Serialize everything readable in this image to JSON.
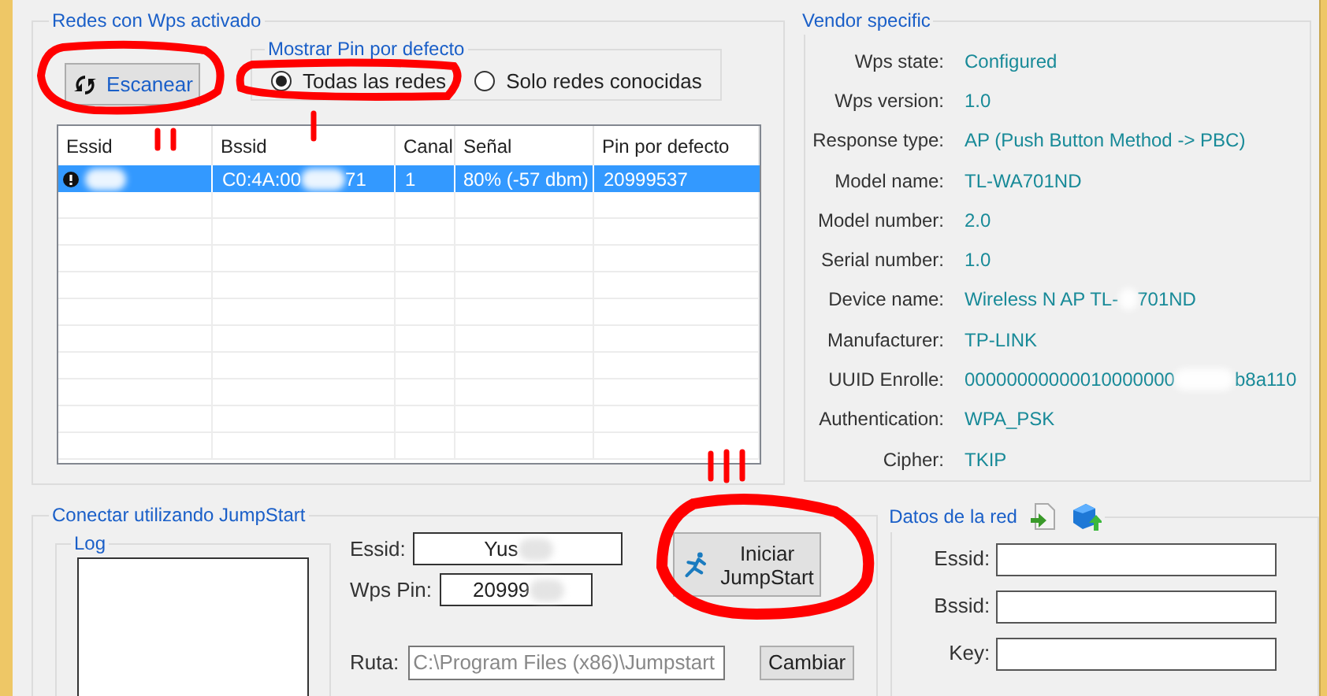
{
  "scan_group": {
    "title": "Redes con Wps activado",
    "scan_button": "Escanear",
    "pin_filter": {
      "title": "Mostrar Pin por defecto",
      "options": [
        {
          "label": "Todas las redes",
          "selected": true
        },
        {
          "label": "Solo redes conocidas",
          "selected": false
        }
      ]
    }
  },
  "table": {
    "columns": [
      "Essid",
      "Bssid",
      "Canal",
      "Señal",
      "Pin por defecto"
    ],
    "rows": [
      {
        "selected": true,
        "bssid_start": "C0:4A:00",
        "bssid_end": "71",
        "canal": "1",
        "senal": "80% (-57 dbm)",
        "pin": "20999537"
      }
    ]
  },
  "vendor": {
    "title": "Vendor specific",
    "rows": [
      {
        "label": "Wps state:",
        "value": "Configured"
      },
      {
        "label": "Wps version:",
        "value": "1.0"
      },
      {
        "label": "Response type:",
        "value": "AP (Push Button Method -> PBC)"
      },
      {
        "label": "Model name:",
        "value": "TL-WA701ND"
      },
      {
        "label": "Model number:",
        "value": "2.0"
      },
      {
        "label": "Serial number:",
        "value": "1.0"
      },
      {
        "label": "Device name:",
        "value": "Wireless N AP TL-",
        "value_end": "701ND"
      },
      {
        "label": "Manufacturer:",
        "value": "TP-LINK"
      },
      {
        "label": "UUID Enrolle:",
        "value": "00000000000010000000",
        "value_end": "b8a110"
      },
      {
        "label": "Authentication:",
        "value": "WPA_PSK"
      },
      {
        "label": "Cipher:",
        "value": "TKIP"
      }
    ]
  },
  "jumpstart": {
    "title": "Conectar utilizando JumpStart",
    "log_title": "Log",
    "essid_label": "Essid:",
    "essid_value": "Yus",
    "pin_label": "Wps Pin:",
    "pin_value": "20999",
    "start_button": "Iniciar JumpStart",
    "path_label": "Ruta:",
    "path_value": "C:\\Program Files (x86)\\Jumpstart",
    "change_button": "Cambiar"
  },
  "network": {
    "title": "Datos de la red",
    "fields": [
      {
        "label": "Essid:"
      },
      {
        "label": "Bssid:"
      },
      {
        "label": "Key:"
      }
    ]
  }
}
